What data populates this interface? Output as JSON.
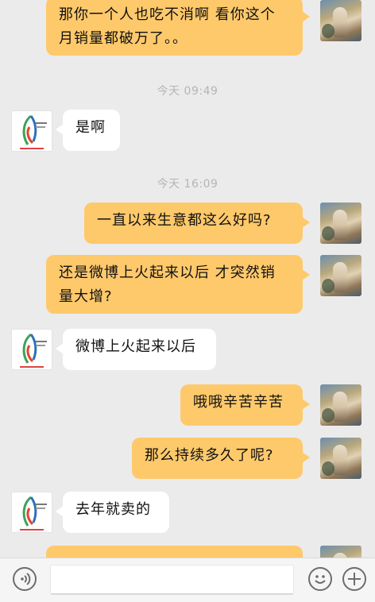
{
  "messages": {
    "m1": "那你一个人也吃不消啊 看你这个月销量都破万了。。",
    "ts1": "今天 09:49",
    "m2": "是啊",
    "ts2": "今天 16:09",
    "m3": "一直以来生意都这么好吗?",
    "m4": "还是微博上火起来以后 才突然销量大增?",
    "m5": "微博上火起来以后",
    "m6": "哦哦辛苦辛苦",
    "m7": "那么持续多久了呢?",
    "m8": "去年就卖的"
  },
  "input": {
    "value": "",
    "placeholder": ""
  },
  "icons": {
    "voice": "voice-icon",
    "emoji": "emoji-icon",
    "add": "add-icon"
  },
  "colors": {
    "bubble_me": "#fec96b",
    "bubble_other": "#ffffff",
    "background": "#ebebeb"
  }
}
